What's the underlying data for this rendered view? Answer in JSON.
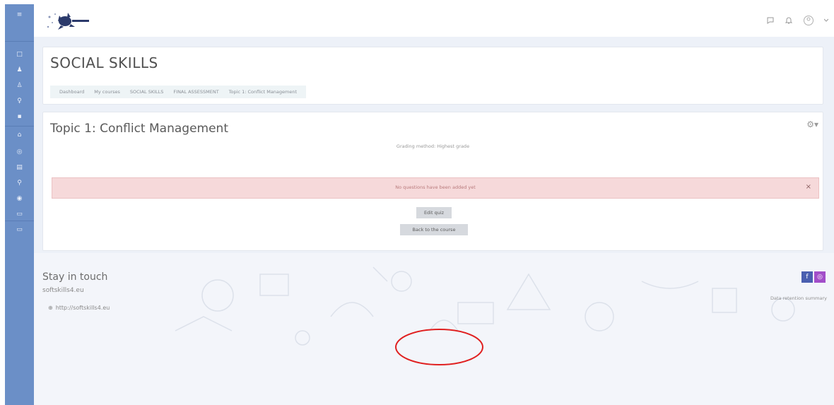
{
  "sidebar": {
    "items": [
      {
        "icon": "menu-icon",
        "glyph": "≡"
      },
      {
        "icon": "square-icon",
        "glyph": "□"
      },
      {
        "icon": "people-icon",
        "glyph": "♟"
      },
      {
        "icon": "bell-icon",
        "glyph": "♙"
      },
      {
        "icon": "chat-icon",
        "glyph": "♀"
      },
      {
        "icon": "book-icon",
        "glyph": "▪"
      },
      {
        "icon": "home-icon",
        "glyph": "⌂"
      },
      {
        "icon": "award-icon",
        "glyph": "◎"
      },
      {
        "icon": "list-icon",
        "glyph": "▤"
      },
      {
        "icon": "tag-icon",
        "glyph": "⚲"
      },
      {
        "icon": "badge-icon",
        "glyph": "◉"
      },
      {
        "icon": "folder-icon",
        "glyph": "▭"
      },
      {
        "icon": "file-icon",
        "glyph": "▭"
      }
    ]
  },
  "navbar": {
    "icons": [
      "chat-icon",
      "bell-icon",
      "user-icon",
      "chevron-down-icon"
    ]
  },
  "page": {
    "title": "SOCIAL SKILLS",
    "breadcrumb": [
      "Dashboard",
      "My courses",
      "SOCIAL SKILLS",
      "FINAL ASSESSMENT",
      "Topic 1: Conflict Management"
    ]
  },
  "quiz": {
    "title": "Topic 1: Conflict Management",
    "grading": "Grading method: Highest grade",
    "alert": "No questions have been added yet",
    "alert_close": "×",
    "edit_button": "Edit quiz",
    "back_button": "Back to the course"
  },
  "footer": {
    "heading": "Stay in touch",
    "site": "softskills4.eu",
    "link": "http://softskills4.eu",
    "social": [
      "f",
      "◎"
    ],
    "retention": "Data retention summary"
  },
  "colors": {
    "sidebar": "#6b8fc7",
    "alert_bg": "#f6d9da",
    "annotation": "#e02020"
  }
}
